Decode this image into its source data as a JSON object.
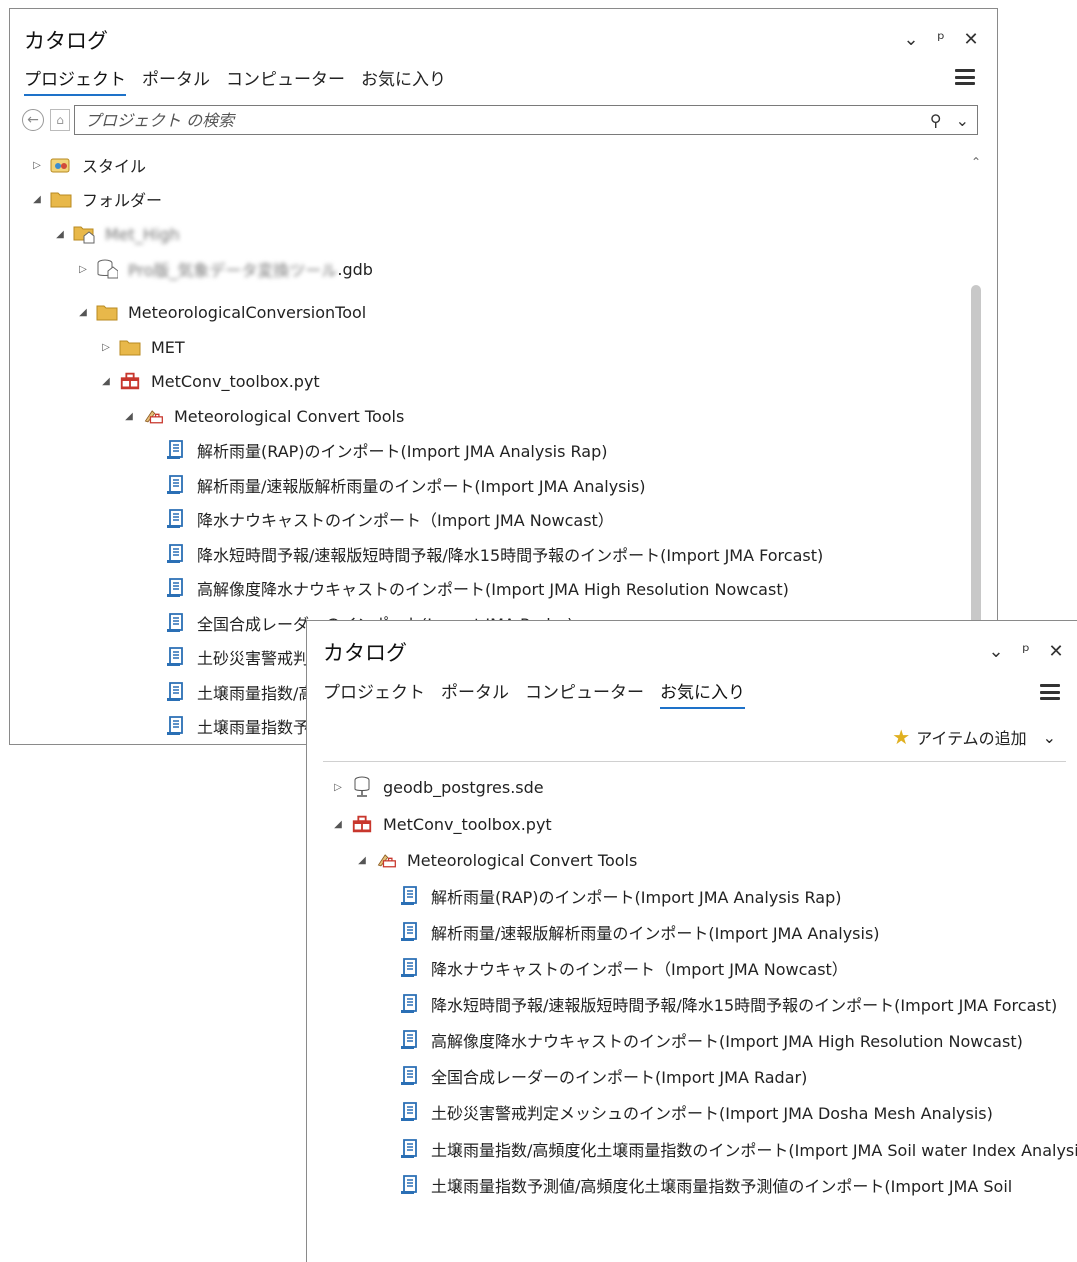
{
  "pane1": {
    "title": "カタログ",
    "tabs": [
      {
        "label": "プロジェクト",
        "active": true
      },
      {
        "label": "ポータル",
        "active": false
      },
      {
        "label": "コンピューター",
        "active": false
      },
      {
        "label": "お気に入り",
        "active": false
      }
    ],
    "search_placeholder": "プロジェクト の検索",
    "tree": [
      {
        "label": "スタイル",
        "expander": "right",
        "icon": "style-icon",
        "level": 0
      },
      {
        "label": "フォルダー",
        "expander": "down",
        "icon": "folder-icon",
        "level": 0
      },
      {
        "label": "Met_High",
        "expander": "down",
        "icon": "home-folder-icon",
        "level": 1,
        "blurred": true
      },
      {
        "label_blur": "Pro版_気象データ変換ツール",
        "label": ".gdb",
        "expander": "right",
        "icon": "geodatabase-icon",
        "level": 2,
        "blurred_prefix": true
      },
      {
        "label": "MeteorologicalConversionTool",
        "expander": "down",
        "icon": "folder-icon",
        "level": 2
      },
      {
        "label": "MET",
        "expander": "right",
        "icon": "folder-icon",
        "level": 3
      },
      {
        "label": "MetConv_toolbox.pyt",
        "expander": "down",
        "icon": "python-toolbox-icon",
        "level": 3
      },
      {
        "label": "Meteorological Convert Tools",
        "expander": "down",
        "icon": "toolset-icon",
        "level": 4
      },
      {
        "label": "解析雨量(RAP)のインポート(Import JMA Analysis Rap)",
        "icon": "script-tool-icon",
        "level": 5
      },
      {
        "label": "解析雨量/速報版解析雨量のインポート(Import JMA Analysis)",
        "icon": "script-tool-icon",
        "level": 5
      },
      {
        "label": "降水ナウキャストのインポート（Import JMA Nowcast）",
        "icon": "script-tool-icon",
        "level": 5
      },
      {
        "label": "降水短時間予報/速報版短時間予報/降水15時間予報のインポート(Import JMA Forcast)",
        "icon": "script-tool-icon",
        "level": 5
      },
      {
        "label": "高解像度降水ナウキャストのインポート(Import JMA High Resolution Nowcast)",
        "icon": "script-tool-icon",
        "level": 5
      },
      {
        "label": "全国合成レーダーのインポート(Import JMA Radar)",
        "icon": "script-tool-icon",
        "level": 5
      },
      {
        "label": "土砂災害警戒判定メッシュのインポート(Import JMA Dosha Mesh Analysis)",
        "icon": "script-tool-icon",
        "level": 5
      },
      {
        "label": "土壌雨量指数/高頻度化土壌雨量指数のインポート(Import JMA Soil water Index Analysis)",
        "icon": "script-tool-icon",
        "level": 5
      },
      {
        "label": "土壌雨量指数予測値/高頻度化土壌雨量指数予測値のインポート(Import JMA Soil",
        "icon": "script-tool-icon",
        "level": 5
      }
    ]
  },
  "pane2": {
    "title": "カタログ",
    "tabs": [
      {
        "label": "プロジェクト",
        "active": false
      },
      {
        "label": "ポータル",
        "active": false
      },
      {
        "label": "コンピューター",
        "active": false
      },
      {
        "label": "お気に入り",
        "active": true
      }
    ],
    "add_item_label": "アイテムの追加",
    "tree": [
      {
        "label": "geodb_postgres.sde",
        "expander": "right",
        "icon": "database-connection-icon",
        "level": 0
      },
      {
        "label": "MetConv_toolbox.pyt",
        "expander": "down",
        "icon": "python-toolbox-icon",
        "level": 0
      },
      {
        "label": "Meteorological Convert Tools",
        "expander": "down",
        "icon": "toolset-icon",
        "level": 1
      },
      {
        "label": "解析雨量(RAP)のインポート(Import JMA Analysis Rap)",
        "icon": "script-tool-icon",
        "level": 2
      },
      {
        "label": "解析雨量/速報版解析雨量のインポート(Import JMA Analysis)",
        "icon": "script-tool-icon",
        "level": 2
      },
      {
        "label": "降水ナウキャストのインポート（Import JMA Nowcast）",
        "icon": "script-tool-icon",
        "level": 2
      },
      {
        "label": "降水短時間予報/速報版短時間予報/降水15時間予報のインポート(Import JMA Forcast)",
        "icon": "script-tool-icon",
        "level": 2
      },
      {
        "label": "高解像度降水ナウキャストのインポート(Import JMA High Resolution Nowcast)",
        "icon": "script-tool-icon",
        "level": 2
      },
      {
        "label": "全国合成レーダーのインポート(Import JMA Radar)",
        "icon": "script-tool-icon",
        "level": 2
      },
      {
        "label": "土砂災害警戒判定メッシュのインポート(Import JMA Dosha Mesh Analysis)",
        "icon": "script-tool-icon",
        "level": 2
      },
      {
        "label": "土壌雨量指数/高頻度化土壌雨量指数のインポート(Import JMA Soil water Index Analysis)",
        "icon": "script-tool-icon",
        "level": 2
      },
      {
        "label": "土壌雨量指数予測値/高頻度化土壌雨量指数予測値のインポート(Import JMA Soil",
        "icon": "script-tool-icon",
        "level": 2
      }
    ]
  },
  "colors": {
    "accent": "#1e72c9",
    "folder": "#e8b84a",
    "toolbox_red": "#c8372d",
    "script_blue": "#2a6fb5"
  }
}
